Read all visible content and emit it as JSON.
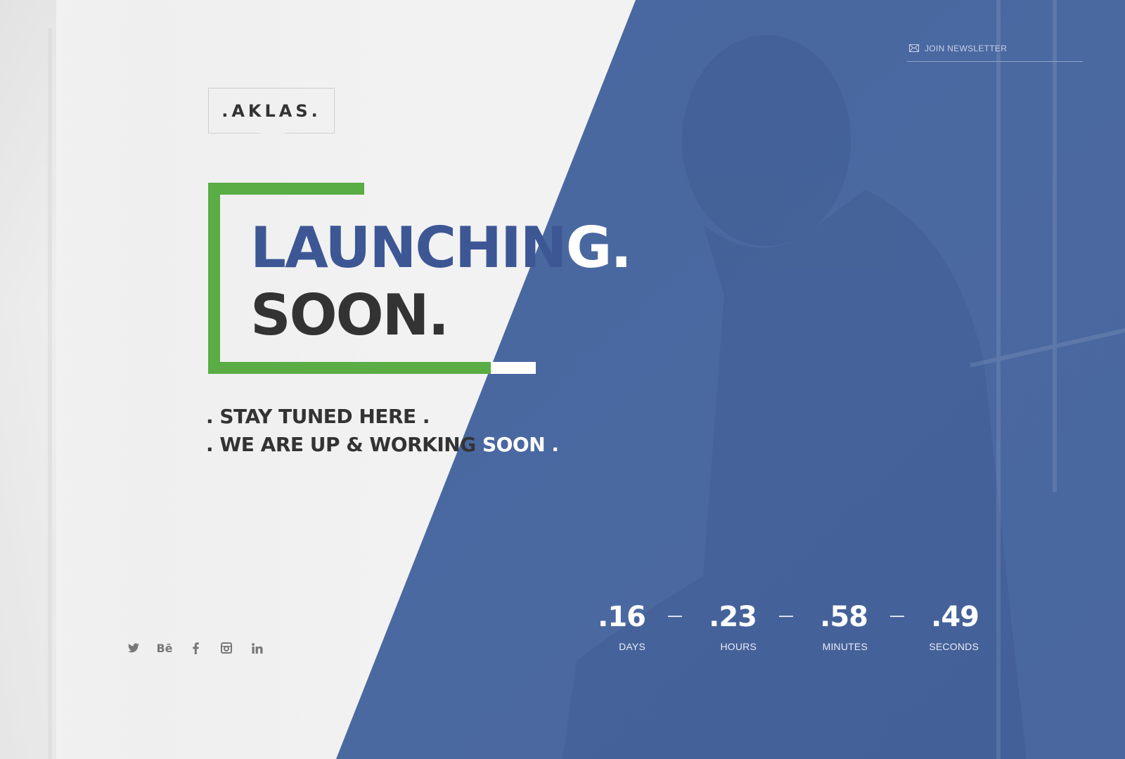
{
  "colors": {
    "accent_blue": "#3d5795",
    "overlay_blue": "#4a68a0",
    "accent_green": "#5aac44",
    "text_dark": "#333333",
    "text_white": "#ffffff"
  },
  "header": {
    "newsletter": {
      "icon": "envelope-icon",
      "label": "JOIN NEWSLETTER"
    }
  },
  "logo": {
    "text": ".AKLAS."
  },
  "hero": {
    "line1_blue": "LAUNCHIN",
    "line1_white": "G.",
    "line2": "SOON."
  },
  "tagline": {
    "line1": ". STAY TUNED HERE .",
    "line2_dark": ". WE ARE UP & WORKING ",
    "line2_white": "SOON ."
  },
  "countdown": [
    {
      "value": ".16",
      "label": "DAYS"
    },
    {
      "value": ".23",
      "label": "HOURS"
    },
    {
      "value": ".58",
      "label": "MINUTES"
    },
    {
      "value": ".49",
      "label": "SECONDS"
    }
  ],
  "social": [
    {
      "name": "twitter",
      "icon": "twitter-icon"
    },
    {
      "name": "behance",
      "icon": "behance-icon",
      "glyph": "Bē"
    },
    {
      "name": "facebook",
      "icon": "facebook-icon"
    },
    {
      "name": "instagram",
      "icon": "instagram-icon"
    },
    {
      "name": "linkedin",
      "icon": "linkedin-icon"
    }
  ]
}
